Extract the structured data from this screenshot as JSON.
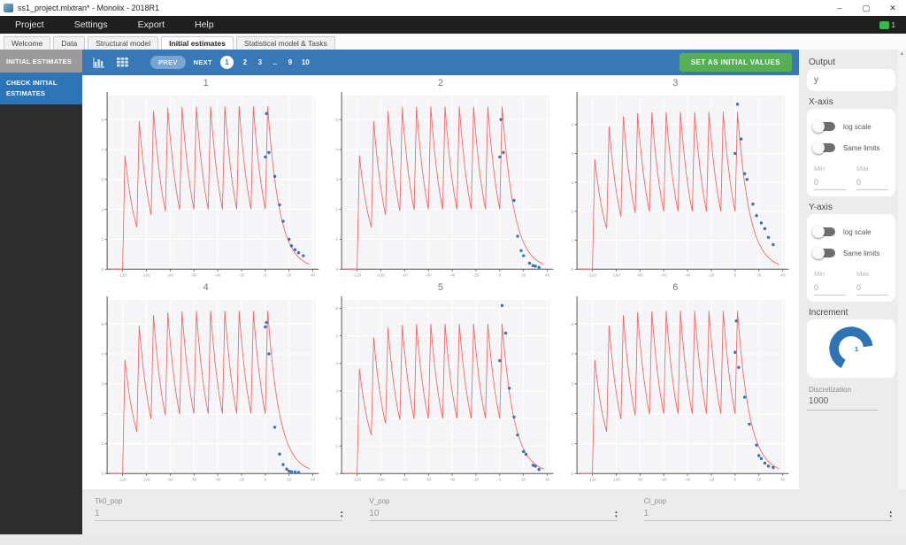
{
  "window": {
    "title": "ss1_project.mlxtran* - Monolix - 2018R1"
  },
  "menubar": {
    "items": [
      {
        "label": "Project"
      },
      {
        "label": "Settings"
      },
      {
        "label": "Export"
      },
      {
        "label": "Help"
      }
    ],
    "notification_count": "1"
  },
  "tabs": [
    {
      "label": "Welcome",
      "active": false
    },
    {
      "label": "Data",
      "active": false
    },
    {
      "label": "Structural model",
      "active": false
    },
    {
      "label": "Initial estimates",
      "active": true
    },
    {
      "label": "Statistical model & Tasks",
      "active": false
    }
  ],
  "sidebar": {
    "header": "INITIAL ESTIMATES",
    "items": [
      {
        "label": "CHECK INITIAL ESTIMATES",
        "active": true
      }
    ]
  },
  "toolbar": {
    "icons": [
      "bar-chart-icon",
      "grid-icon"
    ],
    "prev_label": "PREV",
    "next_label": "NEXT",
    "pages": [
      "1",
      "2",
      "3",
      "..",
      "9",
      "10"
    ],
    "active_page": "1",
    "set_button": "SET AS INITIAL VALUES"
  },
  "right_panel": {
    "output": {
      "label": "Output",
      "value": "y"
    },
    "x_axis": {
      "label": "X-axis",
      "toggles": [
        {
          "label": "log scale",
          "on": false
        },
        {
          "label": "Same limits",
          "on": false
        }
      ],
      "min_label": "Min",
      "max_label": "Max",
      "min": "0",
      "max": "0"
    },
    "y_axis": {
      "label": "Y-axis",
      "toggles": [
        {
          "label": "log scale",
          "on": false
        },
        {
          "label": "Same limits",
          "on": false
        }
      ],
      "min_label": "Min",
      "max_label": "Max",
      "min": "0",
      "max": "0"
    },
    "increment": {
      "label": "Increment",
      "value": "1"
    },
    "discretization": {
      "label": "Discretization",
      "value": "1000"
    }
  },
  "parameters": [
    {
      "name": "Tk0_pop",
      "value": "1"
    },
    {
      "name": "V_pop",
      "value": "10"
    },
    {
      "name": "Cl_pop",
      "value": "1"
    }
  ],
  "colors": {
    "accent_blue": "#3878b6",
    "green_button": "#55b055",
    "sidebar_active": "#2d75b6"
  },
  "chart_data": {
    "type": "line",
    "layout": {
      "rows": 2,
      "cols": 3
    },
    "xlim": [
      -133,
      42
    ],
    "xticks": [
      -120,
      -100,
      -80,
      -60,
      -40,
      -20,
      0,
      20,
      40
    ],
    "plot_bg": "#f5f5f8",
    "curve_color": "#f16a6a",
    "point_color": "#3a72b2",
    "curve": {
      "description": "population PK prediction: 11 repeated doses then washout",
      "first_dose_time": -120,
      "dose_interval": 12,
      "n_doses": 11,
      "dose_amplitude": 3.8,
      "rise_duration": 2,
      "elimination_rate": 0.1,
      "t_start": -130,
      "t_end": 37
    },
    "subplots": [
      {
        "title": "1",
        "ymax": 5.8,
        "yticks": [
          0,
          1,
          2,
          3,
          4,
          5
        ],
        "points": [
          [
            0,
            3.75
          ],
          [
            1,
            5.2
          ],
          [
            3,
            3.9
          ],
          [
            8,
            3.1
          ],
          [
            12,
            2.15
          ],
          [
            15,
            1.6
          ],
          [
            20,
            1.0
          ],
          [
            22,
            0.78
          ],
          [
            25,
            0.65
          ],
          [
            28,
            0.55
          ],
          [
            32,
            0.45
          ]
        ]
      },
      {
        "title": "2",
        "ymax": 5.8,
        "yticks": [
          0,
          1,
          2,
          3,
          4,
          5
        ],
        "points": [
          [
            0,
            3.75
          ],
          [
            1,
            5.0
          ],
          [
            3,
            3.9
          ],
          [
            12,
            2.3
          ],
          [
            15,
            1.1
          ],
          [
            18,
            0.62
          ],
          [
            20,
            0.45
          ],
          [
            25,
            0.2
          ],
          [
            28,
            0.12
          ],
          [
            30,
            0.1
          ],
          [
            33,
            0.06
          ]
        ]
      },
      {
        "title": "3",
        "ymax": 6.0,
        "yticks": [
          0,
          1,
          2,
          3,
          4,
          5
        ],
        "points": [
          [
            0,
            4.0
          ],
          [
            2,
            5.7
          ],
          [
            5,
            4.5
          ],
          [
            8,
            3.3
          ],
          [
            10,
            3.1
          ],
          [
            15,
            2.25
          ],
          [
            18,
            1.85
          ],
          [
            22,
            1.6
          ],
          [
            25,
            1.4
          ],
          [
            28,
            1.1
          ],
          [
            32,
            0.85
          ]
        ]
      },
      {
        "title": "4",
        "ymax": 5.8,
        "yticks": [
          0,
          1,
          2,
          3,
          4,
          5
        ],
        "points": [
          [
            0,
            4.9
          ],
          [
            1,
            5.05
          ],
          [
            3,
            4.0
          ],
          [
            8,
            1.55
          ],
          [
            12,
            0.65
          ],
          [
            15,
            0.3
          ],
          [
            18,
            0.15
          ],
          [
            20,
            0.08
          ],
          [
            22,
            0.06
          ],
          [
            25,
            0.05
          ],
          [
            28,
            0.04
          ]
        ]
      },
      {
        "title": "5",
        "ymax": 6.3,
        "yticks": [
          0,
          1,
          2,
          3,
          4,
          5,
          6
        ],
        "points": [
          [
            0,
            4.1
          ],
          [
            2,
            6.1
          ],
          [
            5,
            5.1
          ],
          [
            8,
            3.1
          ],
          [
            12,
            2.05
          ],
          [
            15,
            1.4
          ],
          [
            20,
            0.8
          ],
          [
            22,
            0.7
          ],
          [
            28,
            0.3
          ],
          [
            30,
            0.27
          ],
          [
            33,
            0.15
          ]
        ]
      },
      {
        "title": "6",
        "ymax": 5.8,
        "yticks": [
          0,
          1,
          2,
          3,
          4,
          5
        ],
        "points": [
          [
            0,
            4.05
          ],
          [
            1,
            5.1
          ],
          [
            3,
            3.55
          ],
          [
            8,
            2.55
          ],
          [
            12,
            1.65
          ],
          [
            18,
            0.95
          ],
          [
            20,
            0.6
          ],
          [
            22,
            0.5
          ],
          [
            25,
            0.35
          ],
          [
            28,
            0.25
          ],
          [
            32,
            0.2
          ]
        ]
      }
    ]
  }
}
